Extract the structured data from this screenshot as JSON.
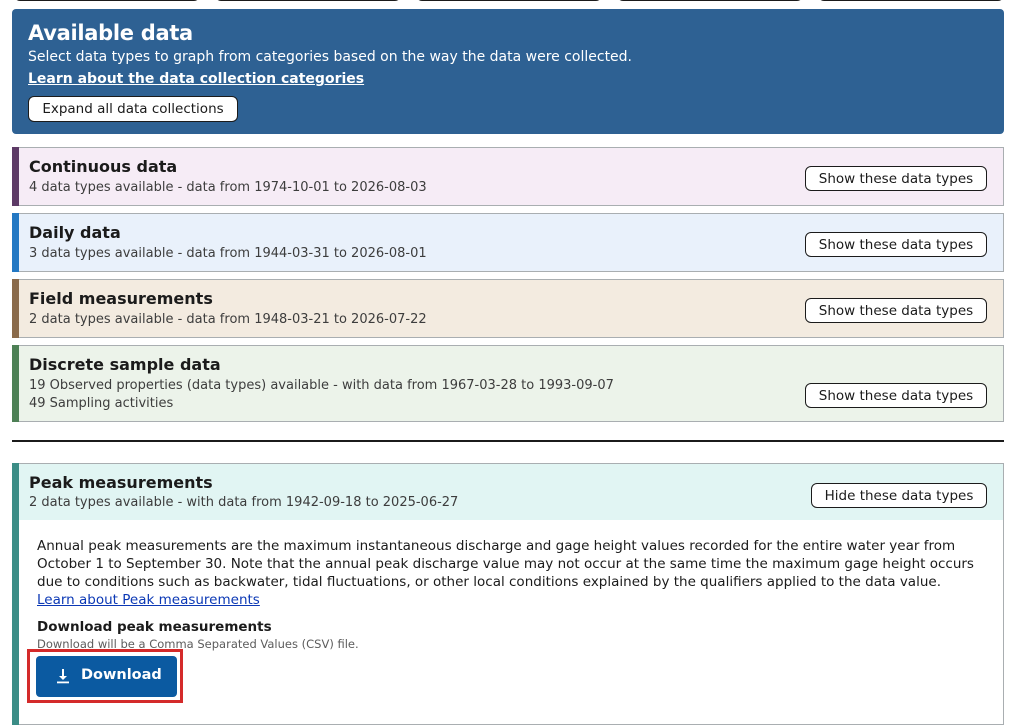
{
  "hero": {
    "title": "Available data",
    "subtitle": "Select data types to graph from categories based on the way the data were collected.",
    "learn_link": "Learn about the data collection categories",
    "expand_label": "Expand all data collections"
  },
  "collections": [
    {
      "title": "Continuous data",
      "meta": "4 data types available - data from 1974-10-01 to 2026-08-03",
      "button": "Show these data types",
      "accent": "#5d3a66"
    },
    {
      "title": "Daily data",
      "meta": "3 data types available - data from 1944-03-31 to 2026-08-01",
      "button": "Show these data types",
      "accent": "#2378c3"
    },
    {
      "title": "Field measurements",
      "meta": "2 data types available - data from 1948-03-21 to 2026-07-22",
      "button": "Show these data types",
      "accent": "#8a6a4a"
    },
    {
      "title": "Discrete sample data",
      "meta": "19 Observed properties (data types) available - with data from 1967-03-28 to 1993-09-07",
      "meta2": "49 Sampling activities",
      "button": "Show these data types",
      "accent": "#4d8055"
    }
  ],
  "peak": {
    "title": "Peak measurements",
    "meta": "2 data types available - with data from 1942-09-18 to 2025-06-27",
    "button": "Hide these data types",
    "description": "Annual peak measurements are the maximum instantaneous discharge and gage height values recorded for the entire water year from October 1 to September 30. Note that the annual peak discharge value may not occur at the same time the maximum gage height occurs due to conditions such as backwater, tidal fluctuations, or other local conditions explained by the qualifiers applied to the data value.",
    "learn_link": "Learn about Peak measurements",
    "download_title": "Download peak measurements",
    "download_note": "Download will be a Comma Separated Values (CSV) file.",
    "download_label": "Download",
    "download_icon": "download-icon"
  },
  "colors": {
    "hero_bg": "#2e6193",
    "download_bg": "#0b5aa1",
    "highlight": "#d42a2a"
  }
}
